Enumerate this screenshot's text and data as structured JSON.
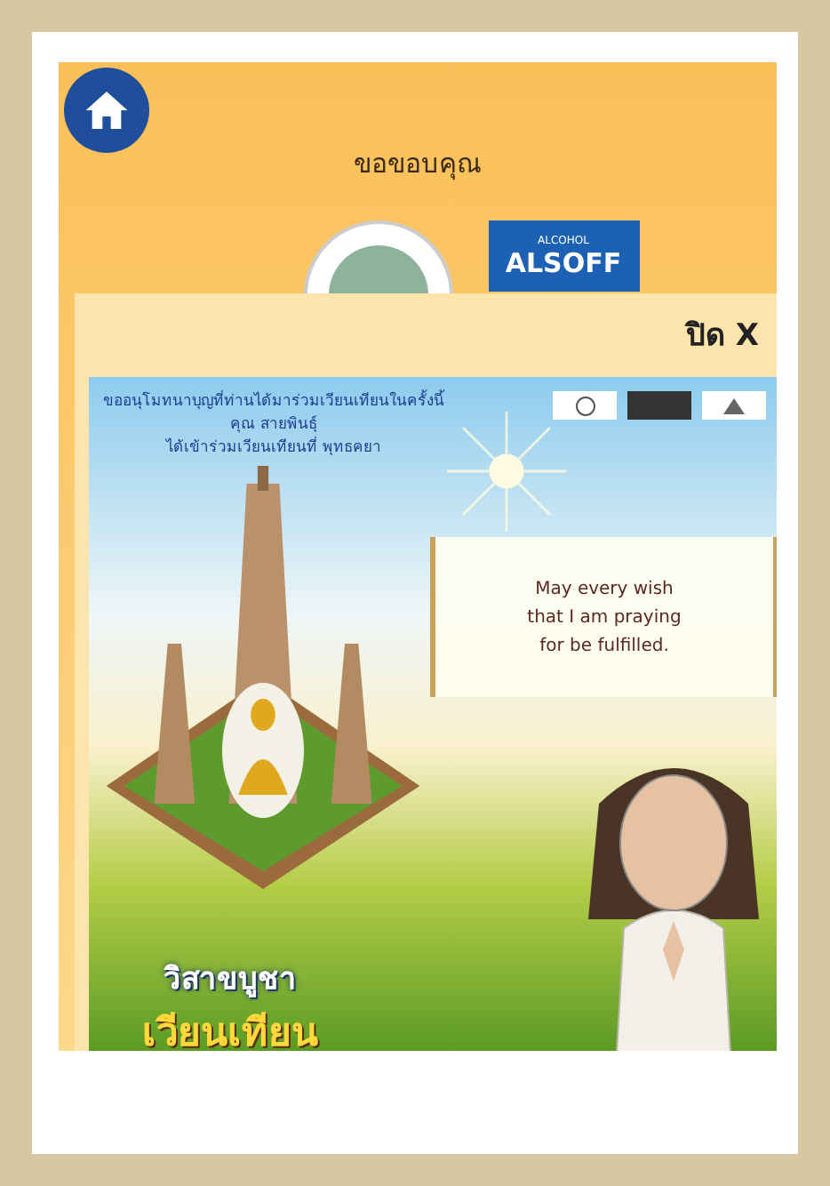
{
  "header": {
    "title": "ขอขอบคุณ",
    "sponsor_logo": {
      "small_text": "ALCOHOL",
      "name": "ALSOFF"
    }
  },
  "modal": {
    "close_label": "ปิด X",
    "card": {
      "caption_lines": [
        "ขออนุโมทนาบุญที่ท่านได้มาร่วมเวียนเทียนในครั้งนี้",
        "คุณ สายพินธุ์",
        "ได้เข้าร่วมเวียนเทียนที่ พุทธคยา"
      ],
      "message_lines": [
        "May every wish",
        "that I am praying",
        "for be fulfilled."
      ],
      "event_title": [
        "วิสาขบูชา",
        "เวียนเทียน"
      ]
    }
  }
}
